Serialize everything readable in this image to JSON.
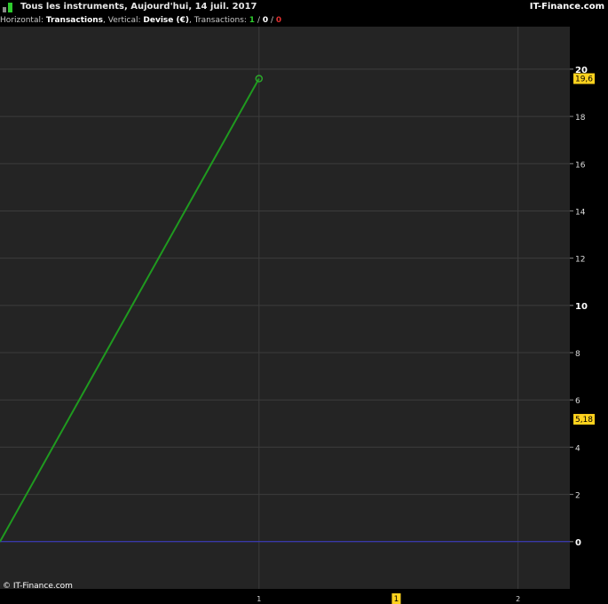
{
  "header": {
    "title": "Tous les instruments, Aujourd'hui, 14 juil. 2017",
    "brand": "IT-Finance.com",
    "icon": "bar-chart-icon"
  },
  "info": {
    "horizontal_label": "Horizontal:",
    "horizontal_value": "Transactions",
    "vertical_label": ", Vertical:",
    "vertical_value": "Devise (€)",
    "transactions_label": ", Transactions:",
    "count_win": "1",
    "count_neutral": "0",
    "count_loss": "0",
    "sep": "/"
  },
  "copyright": "© IT-Finance.com",
  "colors": {
    "line": "#1f9a1f",
    "baseline": "#3a3ad0",
    "tag": "#ffd21e",
    "grid": "#3c3c3c",
    "background": "#242424"
  },
  "chart_data": {
    "type": "line",
    "x": [
      0,
      1
    ],
    "series": [
      {
        "values": [
          0,
          19.6
        ]
      }
    ],
    "baseline": 0,
    "xlim": [
      0,
      2.2
    ],
    "ylim": [
      -2,
      21.8
    ],
    "yticks": [
      0,
      2,
      4,
      6,
      8,
      10,
      12,
      14,
      16,
      18,
      20
    ],
    "ytick_labels": [
      "0",
      "2",
      "4",
      "6",
      "8",
      "10",
      "12",
      "14",
      "16",
      "18",
      "20"
    ],
    "ymajor_ticks": [
      0,
      10,
      20
    ],
    "xticks": [
      1,
      2
    ],
    "xtick_labels": [
      "1",
      "2"
    ],
    "markers": [
      {
        "x": 1,
        "y": 19.6,
        "style": "open-circle"
      }
    ],
    "value_tags": [
      {
        "label": "19,6",
        "y": 19.6
      },
      {
        "label": "5,18",
        "y": 5.18
      }
    ],
    "x_marker": {
      "label": "1",
      "x": 1.53
    },
    "grid": true
  }
}
